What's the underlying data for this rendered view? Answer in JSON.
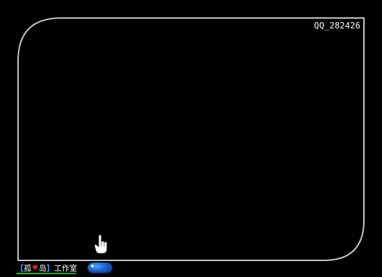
{
  "overlay": {
    "qq_text": "QQ_282426"
  },
  "studio": {
    "bracket_open": "【",
    "name_part1": "孤",
    "name_part2": "岛",
    "bracket_close": "】",
    "suffix": "工作室",
    "heart_char": "♥"
  },
  "icons": {
    "cursor": "hand-pointer-icon",
    "play": "play-pill-icon"
  },
  "colors": {
    "background": "#000000",
    "frame": "#c8c8c8",
    "bracket": "#3d7dff",
    "underline": "#22c43a",
    "pill": "#1a5fc8"
  }
}
